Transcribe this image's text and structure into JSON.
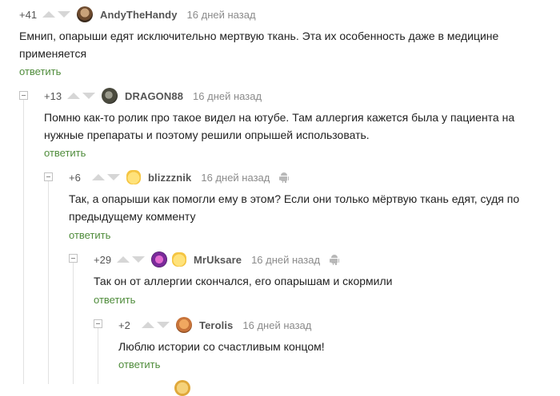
{
  "comments": [
    {
      "rating": "+41",
      "author": "AndyTheHandy",
      "time": "16 дней назад",
      "text": "Емнип, опарыши едят исключительно мертвую ткань. Эта их особенность даже в медицине применяется",
      "reply": "ответить"
    },
    {
      "rating": "+13",
      "author": "DRAGON88",
      "time": "16 дней назад",
      "text": "Помню как-то ролик про такое видел на ютубе. Там аллергия кажется была у пациента  на нужные препараты и поэтому решили опрышей использовать.",
      "reply": "ответить"
    },
    {
      "rating": "+6",
      "author": "blizzznik",
      "time": "16 дней назад",
      "text": "Так, а опарыши как помогли ему в этом? Если они только мёртвую ткань едят, судя по предыдущему комменту",
      "reply": "ответить"
    },
    {
      "rating": "+29",
      "author": "MrUksare",
      "time": "16 дней назад",
      "text": "Так он от аллергии скончался, его опарышам и скормили",
      "reply": "ответить"
    },
    {
      "rating": "+2",
      "author": "Terolis",
      "time": "16 дней назад",
      "text": "Люблю истории со счастливым концом!",
      "reply": "ответить"
    }
  ],
  "colors": {
    "reply_link": "#4f8c3b",
    "timestamp": "#8b8b8b",
    "thread_line": "#e2e2e2"
  },
  "icons": {
    "vote_up": "triangle-up",
    "vote_down": "triangle-down",
    "platform": "android-icon",
    "badge": "yellow-face-badge"
  }
}
